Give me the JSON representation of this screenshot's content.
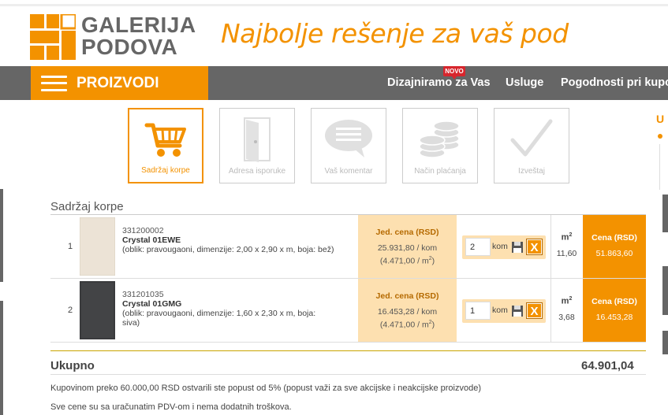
{
  "header": {
    "logo_line1": "GALERIJA",
    "logo_line2": "PODOVA",
    "tagline": "Najbolje rešenje za vaš pod"
  },
  "nav": {
    "products_label": "PROIZVODI",
    "links": [
      "Dizajniramo za Vas",
      "Usluge",
      "Pogodnosti pri kupo"
    ],
    "badge": "NOVO"
  },
  "steps": [
    {
      "label": "Sadržaj korpe",
      "icon": "cart-icon",
      "active": true
    },
    {
      "label": "Adresa isporuke",
      "icon": "door-icon",
      "active": false
    },
    {
      "label": "Vaš komentar",
      "icon": "comment-icon",
      "active": false
    },
    {
      "label": "Način plaćanja",
      "icon": "coins-icon",
      "active": false
    },
    {
      "label": "Izveštaj",
      "icon": "checkmark-icon",
      "active": false
    }
  ],
  "cart": {
    "title": "Sadržaj korpe",
    "items": [
      {
        "num": "1",
        "code": "331200002",
        "name": "Crystal 01EWE",
        "desc": "(oblik: pravougaoni, dimenzije: 2,00 x 2,90 x m, boja: bež)",
        "price_header": "Jed. cena (RSD)",
        "price_per": "25.931,80 / kom",
        "price_m2": "(4.471,00 / m",
        "qty": "2",
        "unit": "kom",
        "m2_header": "m",
        "m2_value": "11,60",
        "total_header": "Cena (RSD)",
        "total_value": "51.863,60",
        "swatch": "#ece3d6"
      },
      {
        "num": "2",
        "code": "331201035",
        "name": "Crystal 01GMG",
        "desc": "(oblik: pravougaoni, dimenzije: 1,60 x 2,30 x m, boja: siva)",
        "price_header": "Jed. cena (RSD)",
        "price_per": "16.453,28 / kom",
        "price_m2": "(4.471,00 / m",
        "qty": "1",
        "unit": "kom",
        "m2_header": "m",
        "m2_value": "3,68",
        "total_header": "Cena (RSD)",
        "total_value": "16.453,28",
        "swatch": "#3a3b3d"
      }
    ],
    "sum_label": "Ukupno",
    "sum_value": "64.901,04",
    "note1": "Kupovinom preko 60.000,00 RSD ostvarili ste popust od 5% (popust važi za sve akcijske i neakcijske proizvode)",
    "note2": "Sve cene su sa uračunatim PDV-om i nema dodatnih troškova."
  },
  "colors": {
    "accent": "#f39200",
    "nav_bg": "#666666",
    "price_bg": "#fde0b0"
  }
}
